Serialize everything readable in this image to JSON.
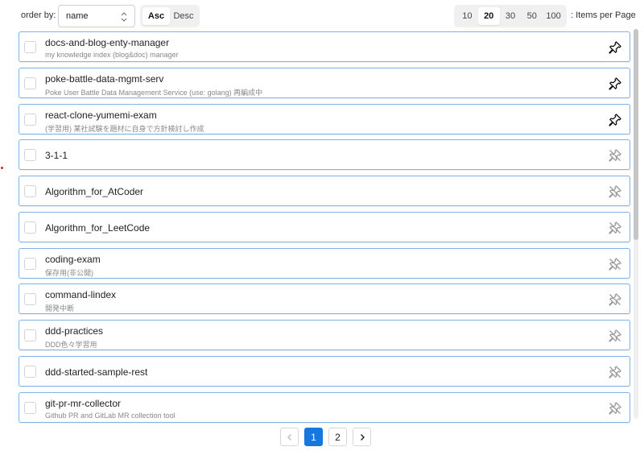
{
  "toolbar": {
    "order_label": "order by:",
    "order_value": "name",
    "asc_label": "Asc",
    "desc_label": "Desc",
    "active_order": "Asc",
    "per_page_options": [
      "10",
      "20",
      "30",
      "50",
      "100"
    ],
    "per_page_selected": "20",
    "per_page_label": ": Items per Page"
  },
  "repos": [
    {
      "name": "docs-and-blog-enty-manager",
      "description": "my knowledge index (blog&doc) manager",
      "pinned": true
    },
    {
      "name": "poke-battle-data-mgmt-serv",
      "description": "Poke User Battle Data Management Service (use: golang) 再編成中",
      "pinned": true
    },
    {
      "name": "react-clone-yumemi-exam",
      "description": "(学習用) 某社試験を題材に自身で方針検討し作成",
      "pinned": true
    },
    {
      "name": "3-1-1",
      "description": "",
      "pinned": false
    },
    {
      "name": "Algorithm_for_AtCoder",
      "description": "",
      "pinned": false
    },
    {
      "name": "Algorithm_for_LeetCode",
      "description": "",
      "pinned": false
    },
    {
      "name": "coding-exam",
      "description": "保存用(非公開)",
      "pinned": false
    },
    {
      "name": "command-lindex",
      "description": "開発中断",
      "pinned": false
    },
    {
      "name": "ddd-practices",
      "description": "DDD色々学習用",
      "pinned": false
    },
    {
      "name": "ddd-started-sample-rest",
      "description": "",
      "pinned": false
    },
    {
      "name": "git-pr-mr-collector",
      "description": "Github PR and GitLab MR collection tool",
      "pinned": false
    }
  ],
  "pagination": {
    "pages": [
      "1",
      "2"
    ],
    "current": "1"
  },
  "colors": {
    "accent": "#1677e0",
    "row_border": "#7fb3e6",
    "pin_active": "#111111",
    "pin_inactive": "#9a9a9a"
  }
}
